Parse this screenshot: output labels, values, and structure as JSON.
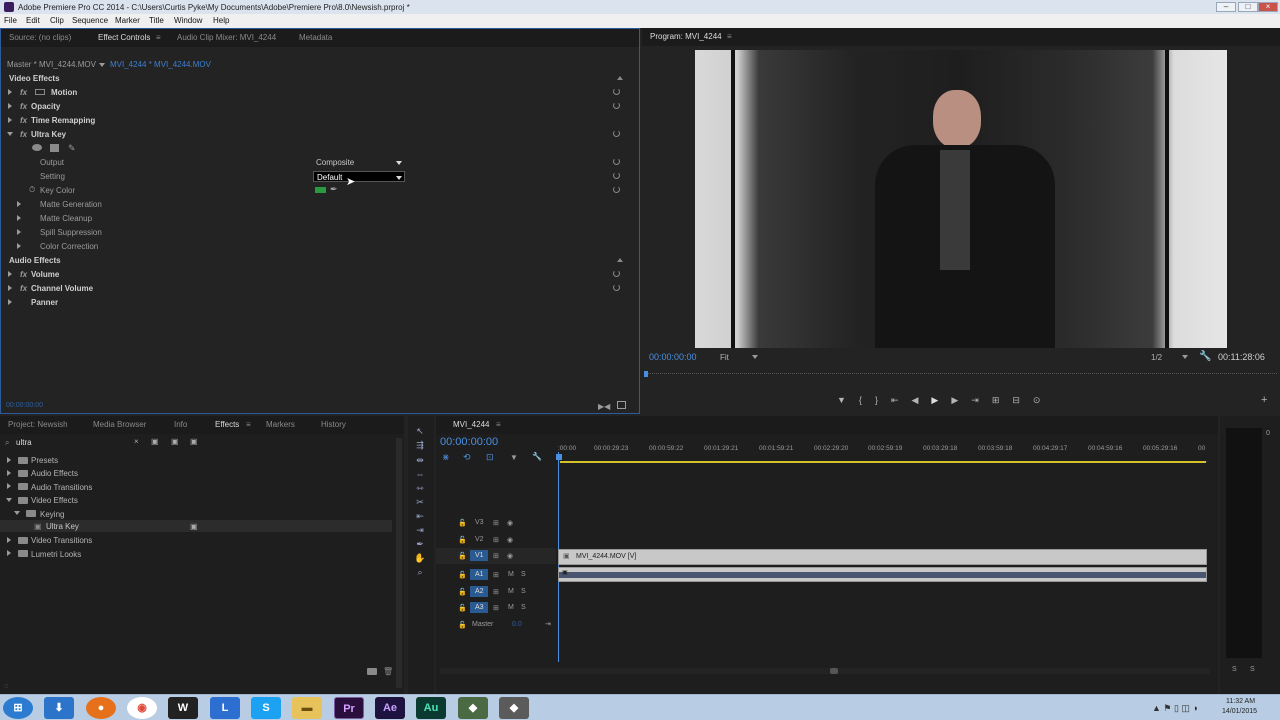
{
  "window": {
    "title": "Adobe Premiere Pro CC 2014 - C:\\Users\\Curtis Pyke\\My Documents\\Adobe\\Premiere Pro\\8.0\\Newsish.prproj *"
  },
  "menu": [
    "File",
    "Edit",
    "Clip",
    "Sequence",
    "Marker",
    "Title",
    "Window",
    "Help"
  ],
  "source_tabs": {
    "source": "Source: (no clips)",
    "effect_controls": "Effect Controls",
    "audio_mixer": "Audio Clip Mixer: MVI_4244",
    "metadata": "Metadata",
    "menu_glyph": "≡"
  },
  "effect_controls": {
    "master": "Master * MVI_4244.MOV",
    "clip": "MVI_4244 * MVI_4244.MOV",
    "video_effects": "Video Effects",
    "video_items": [
      "Motion",
      "Opacity",
      "Time Remapping",
      "Ultra Key"
    ],
    "output_label": "Output",
    "output_value": "Composite",
    "setting_label": "Setting",
    "setting_value": "Default",
    "key_color_label": "Key Color",
    "key_color": "#2b9a3e",
    "sub_items": [
      "Matte Generation",
      "Matte Cleanup",
      "Spill Suppression",
      "Color Correction"
    ],
    "audio_effects": "Audio Effects",
    "audio_items": [
      "Volume",
      "Channel Volume",
      "Panner"
    ],
    "timecode": "00:00:00:00",
    "fx_label": "fx"
  },
  "program": {
    "tab": "Program: MVI_4244",
    "timecode": "00:00:00:00",
    "zoom": "Fit",
    "resolution": "1/2",
    "duration": "00:11:28:06"
  },
  "project_tabs": {
    "project": "Project: Newsish",
    "media_browser": "Media Browser",
    "info": "Info",
    "effects": "Effects",
    "markers": "Markers",
    "history": "History"
  },
  "effects_panel": {
    "search_value": "ultra",
    "tree": [
      {
        "label": "Presets",
        "depth": 0,
        "open": false
      },
      {
        "label": "Audio Effects",
        "depth": 0,
        "open": false
      },
      {
        "label": "Audio Transitions",
        "depth": 0,
        "open": false
      },
      {
        "label": "Video Effects",
        "depth": 0,
        "open": true
      },
      {
        "label": "Keying",
        "depth": 1,
        "open": true
      },
      {
        "label": "Ultra Key",
        "depth": 2,
        "open": false
      },
      {
        "label": "Video Transitions",
        "depth": 0,
        "open": false
      },
      {
        "label": "Lumetri Looks",
        "depth": 0,
        "open": false
      }
    ]
  },
  "timeline": {
    "tab": "MVI_4244",
    "timecode": "00:00:00:00",
    "ruler": [
      ":00:00",
      "00:00:29:23",
      "00:00:59:22",
      "00:01:29:21",
      "00:01:59:21",
      "00:02:29:20",
      "00:02:59:19",
      "00:03:29:18",
      "00:03:59:18",
      "00:04:29:17",
      "00:04:59:16",
      "00:05:29:16",
      "00"
    ],
    "tracks_video": [
      "V3",
      "V2",
      "V1"
    ],
    "tracks_audio": [
      "A1",
      "A2",
      "A3"
    ],
    "master_label": "Master",
    "master_value": "0.0",
    "clip_video": "MVI_4244.MOV [V]",
    "mute": "M",
    "solo": "S"
  },
  "meter": {
    "s1": "S",
    "s2": "S"
  },
  "taskbar": {
    "time": "11:32 AM",
    "date": "14/01/2015"
  }
}
